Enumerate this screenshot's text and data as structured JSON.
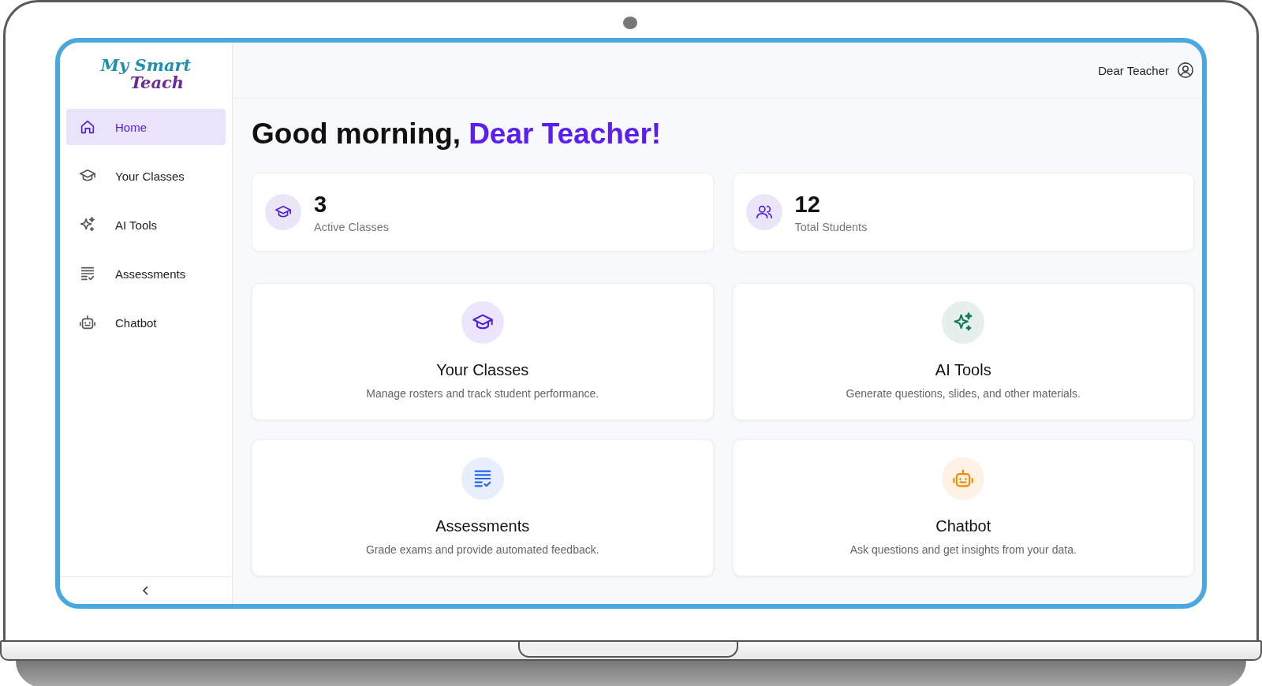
{
  "logo": {
    "line_1": "My Smart",
    "line_2": "Teach"
  },
  "sidebar": {
    "items": [
      {
        "label": "Home",
        "kind": "home",
        "selected": true
      },
      {
        "label": "Your Classes",
        "kind": "classes",
        "selected": false
      },
      {
        "label": "AI Tools",
        "kind": "sparkles",
        "selected": false
      },
      {
        "label": "Assessments",
        "kind": "list",
        "selected": false
      },
      {
        "label": "Chatbot",
        "kind": "bot",
        "selected": false
      }
    ]
  },
  "header": {
    "user_name": "Dear Teacher"
  },
  "greeting": {
    "text": "Good morning,",
    "name": "Dear Teacher!"
  },
  "stats": [
    {
      "value": "3",
      "label": "Active Classes",
      "kind": "classes"
    },
    {
      "value": "12",
      "label": "Total Students",
      "kind": "users"
    }
  ],
  "features": [
    {
      "title": "Your Classes",
      "description": "Manage rosters and track student performance.",
      "kind": "classes",
      "color": "#4f1fe0"
    },
    {
      "title": "AI Tools",
      "description": "Generate questions, slides, and other materials.",
      "kind": "sparkles",
      "color": "#0f7a5c"
    },
    {
      "title": "Assessments",
      "description": "Grade exams and provide automated feedback.",
      "kind": "list",
      "color": "#2563eb"
    },
    {
      "title": "Chatbot",
      "description": "Ask questions and get insights from your data.",
      "kind": "bot",
      "color": "#f08a00"
    }
  ]
}
